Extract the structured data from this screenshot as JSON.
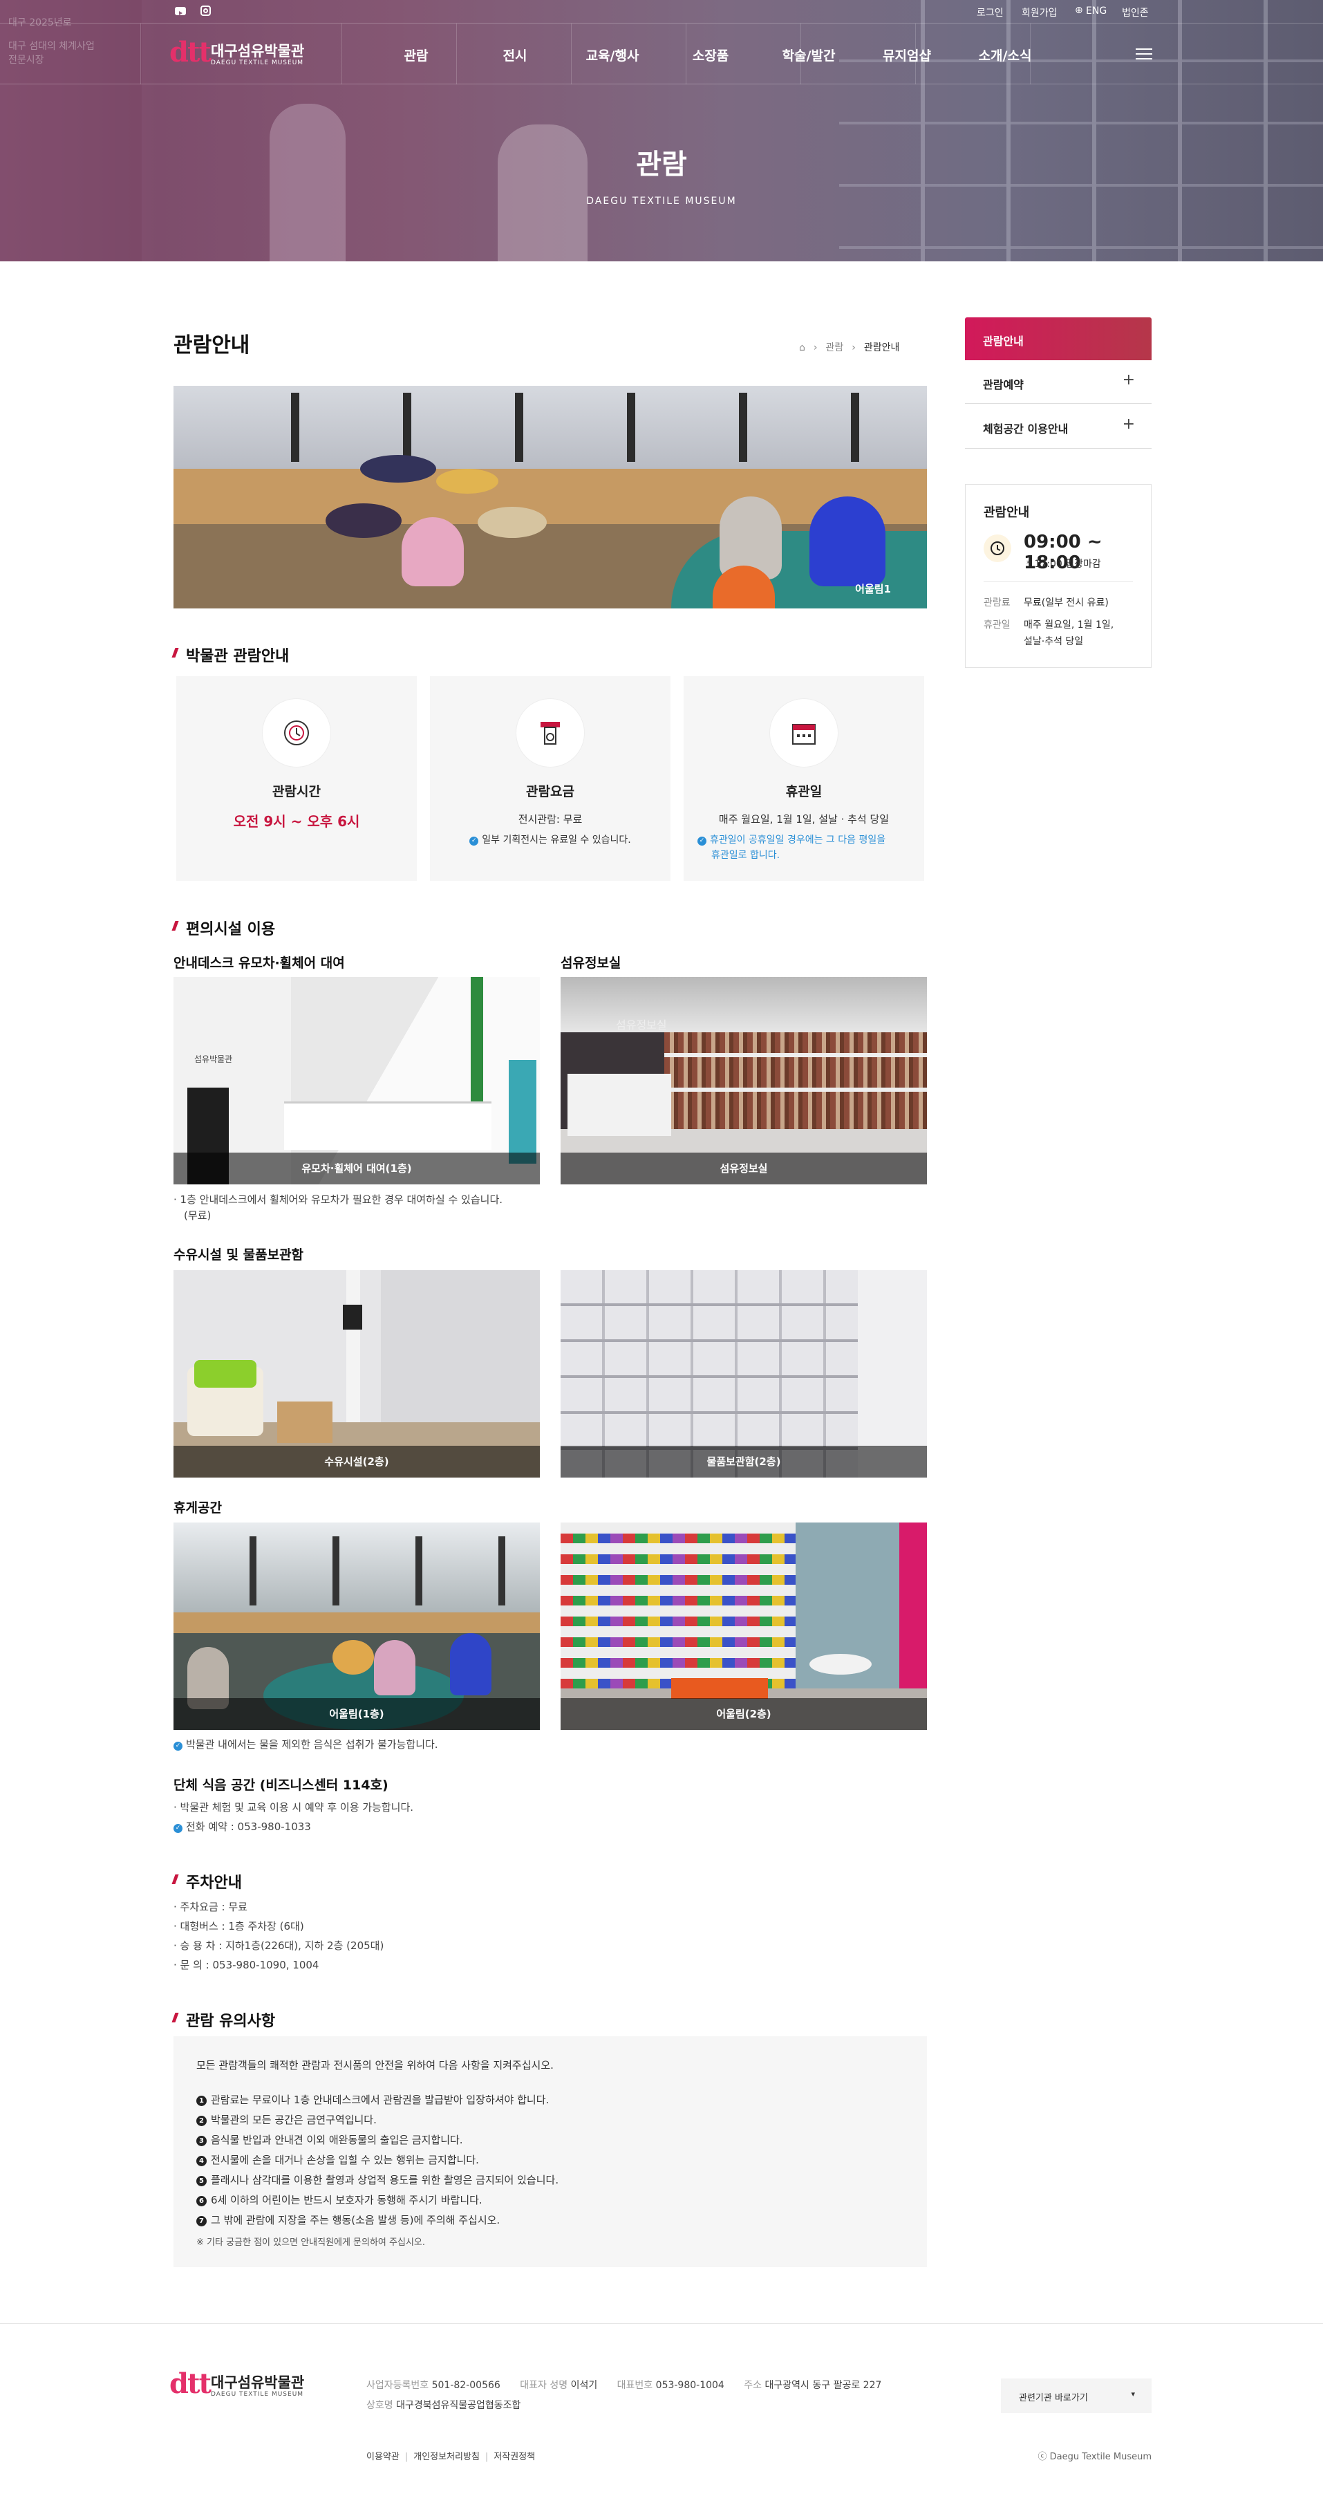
{
  "header": {
    "util_links": [
      "로그인",
      "회원가입",
      "ENG",
      "법인존"
    ],
    "logo_kr": "대구섬유박물관",
    "logo_en": "DAEGU TEXTILE MUSEUM",
    "logo_mark": "dtt",
    "nav": [
      "관람",
      "전시",
      "교육/행사",
      "소장품",
      "학술/발간",
      "뮤지엄샵",
      "소개/소식"
    ],
    "hero_title": "관람",
    "hero_sub": "DAEGU TEXTILE MUSEUM",
    "side_texts": [
      "대구 2025년로",
      "대구 섬대의 체계사업",
      "전문시장"
    ]
  },
  "page": {
    "title": "관람안내",
    "breadcrumb": [
      "관람",
      "관람안내"
    ],
    "main_caption": "어울림1"
  },
  "info": {
    "heading": "박물관 관람안내",
    "cards": [
      {
        "title": "관람시간",
        "highlight": "오전 9시 ~ 오후 6시"
      },
      {
        "title": "관람요금",
        "line": "전시관람: 무료",
        "note": "일부 기획전시는 유료일 수 있습니다."
      },
      {
        "title": "휴관일",
        "line": "매주 월요일, 1월 1일, 설날 · 추석 당일",
        "note1": "휴관일이 공휴일일 경우에는 그 다음 평일을",
        "note2": "휴관일로 합니다."
      }
    ]
  },
  "facilities": {
    "heading": "편의시설 이용",
    "g1_left_title": "안내데스크 유모차·휠체어 대여",
    "g1_right_title": "섬유정보실",
    "cap_stroller": "유모차·휠체어 대여(1층)",
    "cap_library": "섬유정보실",
    "stroller_note1": "1층 안내데스크에서 휠체어와 유모차가 필요한 경우 대여하실 수 있습니다.",
    "stroller_note2": "(무료)",
    "g2_title": "수유시설 및 물품보관함",
    "cap_nursing": "수유시설(2층)",
    "cap_locker": "물품보관함(2층)",
    "g3_title": "휴게공간",
    "cap_rest1": "어울림(1층)",
    "cap_rest2": "어울림(2층)",
    "rest_note": "박물관 내에서는 물을 제외한 음식은 섭취가 불가능합니다.",
    "group_title": "단체 식음 공간 (비즈니스센터 114호)",
    "group_note": "박물관 체험 및 교육 이용 시 예약 후 이용 가능합니다.",
    "group_tel": "전화 예약 : 053-980-1033"
  },
  "parking": {
    "heading": "주차안내",
    "items": [
      "주차요금 : 무료",
      "대형버스 : 1층 주차장 (6대)",
      "승 용 차 : 지하1층(226대), 지하 2층 (205대)",
      "문 의 : 053-980-1090, 1004"
    ]
  },
  "notice": {
    "heading": "관람 유의사항",
    "intro": "모든 관람객들의 쾌적한 관람과 전시품의 안전을 위하여 다음 사항을 지켜주십시오.",
    "rules": [
      "관람료는 무료이나 1층 안내데스크에서 관람권을 발급받아 입장하셔야 합니다.",
      "박물관의 모든 공간은 금연구역입니다.",
      "음식물 반입과 안내견 이외 애완동물의 출입은 금지합니다.",
      "전시물에 손을 대거나 손상을 입힐 수 있는 행위는 금지합니다.",
      "플래시나 삼각대를 이용한 촬영과 상업적 용도를 위한 촬영은 금지되어 있습니다.",
      "6세 이하의 어린이는 반드시 보호자가 동행해 주시기 바랍니다.",
      "그 밖에 관람에 지장을 주는 행동(소음 발생 등)에 주의해 주십시오."
    ],
    "rule_nums": [
      "1",
      "2",
      "3",
      "4",
      "5",
      "6",
      "7"
    ],
    "footnote": "※ 기타 궁금한 점이 있으면 안내직원에게 문의하여 주십시오."
  },
  "sidebar": {
    "menu": [
      "관람안내",
      "관람예약",
      "체험공간 이용안내"
    ],
    "box_title": "관람안내",
    "time": "09:00 ~ 18:00",
    "time_note": "* 17:00 입장마감",
    "fee_label": "관람료",
    "fee_value": "무료(일부 전시 유료)",
    "closed_label": "휴관일",
    "closed_value1": "매주 월요일, 1월 1일,",
    "closed_value2": "설날·추석 당일"
  },
  "footer": {
    "biz_label": "사업자등록번호",
    "biz": "501-82-00566",
    "rep_label": "대표자 성명",
    "rep": "이석기",
    "tel_label": "대표번호",
    "tel": "053-980-1004",
    "addr_label": "주소",
    "addr": "대구광역시 동구 팔공로 227",
    "corp_label": "상호명",
    "corp": "대구경북섬유직물공업협동조합",
    "links": [
      "이용약관",
      "개인정보처리방침",
      "저작권정책"
    ],
    "related": "관련기관 바로가기",
    "copyright": "ⓒ Daegu Textile Museum"
  },
  "colors": {
    "accent": "#c8163f",
    "blue": "#2a8fd6"
  }
}
